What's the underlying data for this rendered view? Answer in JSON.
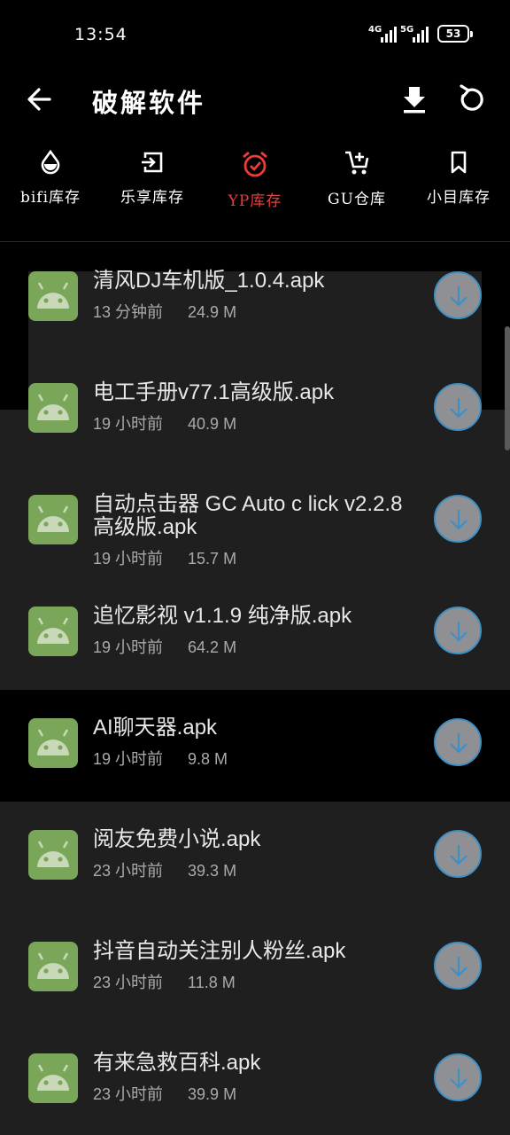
{
  "status": {
    "time": "13:54",
    "signal1": "4G",
    "signal2": "5G",
    "battery": "53"
  },
  "header": {
    "title": "破解软件",
    "back_icon": "arrow-left-icon",
    "download_icon": "download-icon",
    "refresh_icon": "refresh-icon"
  },
  "tabs": [
    {
      "label": "bifi库存",
      "icon": "drop-icon",
      "active": false
    },
    {
      "label": "乐享库存",
      "icon": "login-icon",
      "active": false
    },
    {
      "label": "YP库存",
      "icon": "alarm-check-icon",
      "active": true
    },
    {
      "label": "GU仓库",
      "icon": "cart-add-icon",
      "active": false
    },
    {
      "label": "小目库存",
      "icon": "bookmark-icon",
      "active": false
    }
  ],
  "colors": {
    "accent": "#ee3b3b",
    "app_icon": "#79a658",
    "download_border": "#3e8fc4",
    "background": "#000000",
    "panel": "#1f1f1f"
  },
  "files": [
    {
      "name": "清风DJ车机版_1.0.4.apk",
      "time": "13 分钟前",
      "size": "24.9 M"
    },
    {
      "name": "电工手册v77.1高级版.apk",
      "time": "19 小时前",
      "size": "40.9 M"
    },
    {
      "name": "自动点击器 GC Auto  c lick v2.2.8 高级版.apk",
      "time": "19 小时前",
      "size": "15.7 M"
    },
    {
      "name": "追忆影视 v1.1.9 纯净版.apk",
      "time": "19 小时前",
      "size": "64.2 M"
    },
    {
      "name": "AI聊天器.apk",
      "time": "19 小时前",
      "size": "9.8 M"
    },
    {
      "name": "阅友免费小说.apk",
      "time": "23 小时前",
      "size": "39.3 M"
    },
    {
      "name": "抖音自动关注别人粉丝.apk",
      "time": "23 小时前",
      "size": "11.8 M"
    },
    {
      "name": "有来急救百科.apk",
      "time": "23 小时前",
      "size": "39.9 M"
    }
  ]
}
